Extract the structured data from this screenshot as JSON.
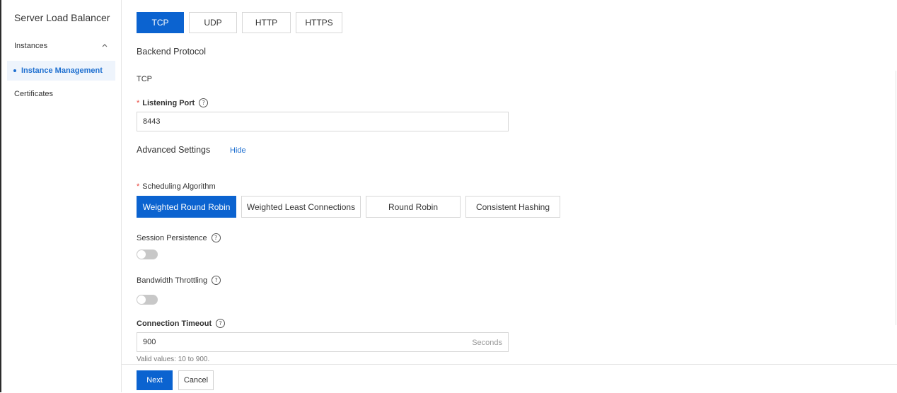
{
  "sidebar": {
    "title": "Server Load Balancer",
    "group_label": "Instances",
    "active_item": "Instance Management",
    "item_certificates": "Certificates"
  },
  "protocol_tabs": [
    "TCP",
    "UDP",
    "HTTP",
    "HTTPS"
  ],
  "selected_protocol": "TCP",
  "backend_protocol": {
    "label": "Backend Protocol",
    "value": "TCP"
  },
  "listening_port": {
    "required_mark": "*",
    "label": "Listening Port",
    "value": "8443"
  },
  "advanced": {
    "label": "Advanced Settings",
    "toggle_link": "Hide"
  },
  "scheduling": {
    "required_mark": "*",
    "label": "Scheduling Algorithm",
    "options": [
      "Weighted Round Robin",
      "Weighted Least Connections",
      "Round Robin",
      "Consistent Hashing"
    ],
    "selected": "Weighted Round Robin"
  },
  "session_persistence": {
    "label": "Session Persistence",
    "enabled": false
  },
  "bandwidth_throttling": {
    "label": "Bandwidth Throttling",
    "enabled": false
  },
  "connection_timeout": {
    "label": "Connection Timeout",
    "value": "900",
    "unit": "Seconds",
    "hint": "Valid values: 10 to 900."
  },
  "help_glyph": "?",
  "footer": {
    "next_label": "Next",
    "cancel_label": "Cancel"
  },
  "colors": {
    "accent": "#0b63d0",
    "link": "#1e6fd0",
    "required": "#e8453c",
    "toggle_off": "#c8c8c8"
  },
  "icons": {
    "collapse": "chevron-up-icon",
    "help": "question-circle-icon"
  }
}
